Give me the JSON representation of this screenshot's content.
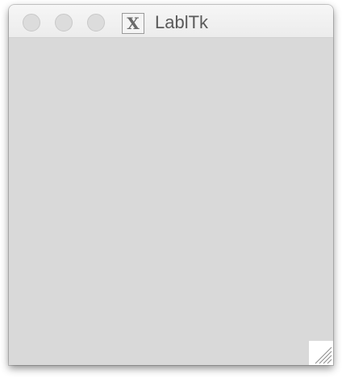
{
  "window": {
    "title": "LablTk",
    "app_icon": {
      "name": "x11-icon",
      "glyph": "X"
    },
    "controls": [
      "close",
      "minimize",
      "zoom"
    ]
  },
  "colors": {
    "content_background": "#d9d9d9",
    "titlebar_background": "#ececec",
    "inactive_traffic_light": "#dcdcdc"
  }
}
